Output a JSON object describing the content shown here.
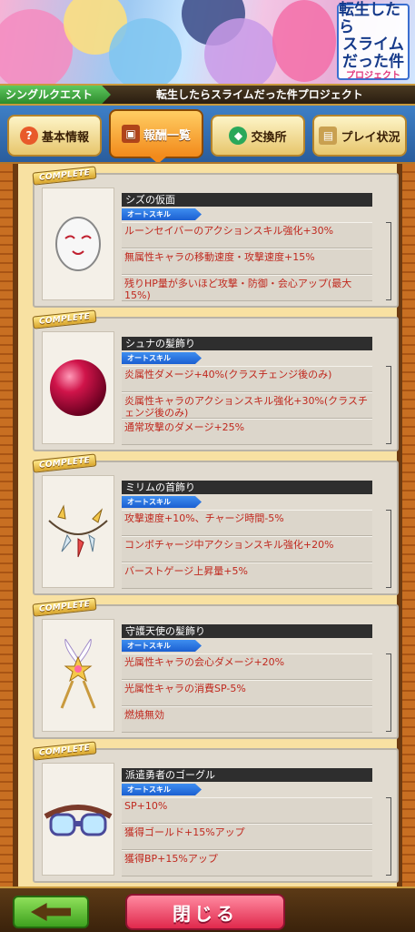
{
  "banner": {
    "logo_line1": "転生したら",
    "logo_line2": "スライム",
    "logo_line3": "だった件",
    "logo_line4": "プロジェクト"
  },
  "titlebar": {
    "mode": "シングルクエスト",
    "quest_title": "転生したらスライムだった件プロジェクト"
  },
  "tabs": [
    {
      "label": "基本情報",
      "icon": "question-icon",
      "active": false
    },
    {
      "label": "報酬一覧",
      "icon": "treasure-chest-icon",
      "active": true
    },
    {
      "label": "交換所",
      "icon": "gems-icon",
      "active": false
    },
    {
      "label": "プレイ状況",
      "icon": "scroll-icon",
      "active": false
    }
  ],
  "cards": [
    {
      "badge": "COMPLETE",
      "name": "シズの仮面",
      "tag": "オートスキル",
      "icon": "mask-icon",
      "effects": [
        "ルーンセイバーのアクションスキル強化+30%",
        "無属性キャラの移動速度・攻撃速度+15%",
        "残りHP量が多いほど攻撃・防御・会心アップ(最大15%)"
      ]
    },
    {
      "badge": "COMPLETE",
      "name": "シュナの髪飾り",
      "tag": "オートスキル",
      "icon": "red-orb-icon",
      "effects": [
        "炎属性ダメージ+40%(クラスチェンジ後のみ)",
        "炎属性キャラのアクションスキル強化+30%(クラスチェンジ後のみ)",
        "通常攻撃のダメージ+25%"
      ]
    },
    {
      "badge": "COMPLETE",
      "name": "ミリムの首飾り",
      "tag": "オートスキル",
      "icon": "fang-necklace-icon",
      "effects": [
        "攻撃速度+10%、チャージ時間-5%",
        "コンボチャージ中アクションスキル強化+20%",
        "バーストゲージ上昇量+5%"
      ]
    },
    {
      "badge": "COMPLETE",
      "name": "守護天使の髪飾り",
      "tag": "オートスキル",
      "icon": "winged-star-icon",
      "effects": [
        "光属性キャラの会心ダメージ+20%",
        "光属性キャラの消費SP-5%",
        "燃焼無効"
      ]
    },
    {
      "badge": "COMPLETE",
      "name": "派遣勇者のゴーグル",
      "tag": "オートスキル",
      "icon": "goggles-icon",
      "effects": [
        "SP+10%",
        "獲得ゴールド+15%アップ",
        "獲得BP+15%アップ"
      ]
    }
  ],
  "bottom": {
    "back_icon": "back-arrow-icon",
    "close_label": "閉じる"
  },
  "colors": {
    "effect_text": "#c0281e",
    "tag_blue": "#1b5fd1",
    "close_pink": "#e0284c",
    "back_green": "#3ea21f"
  }
}
